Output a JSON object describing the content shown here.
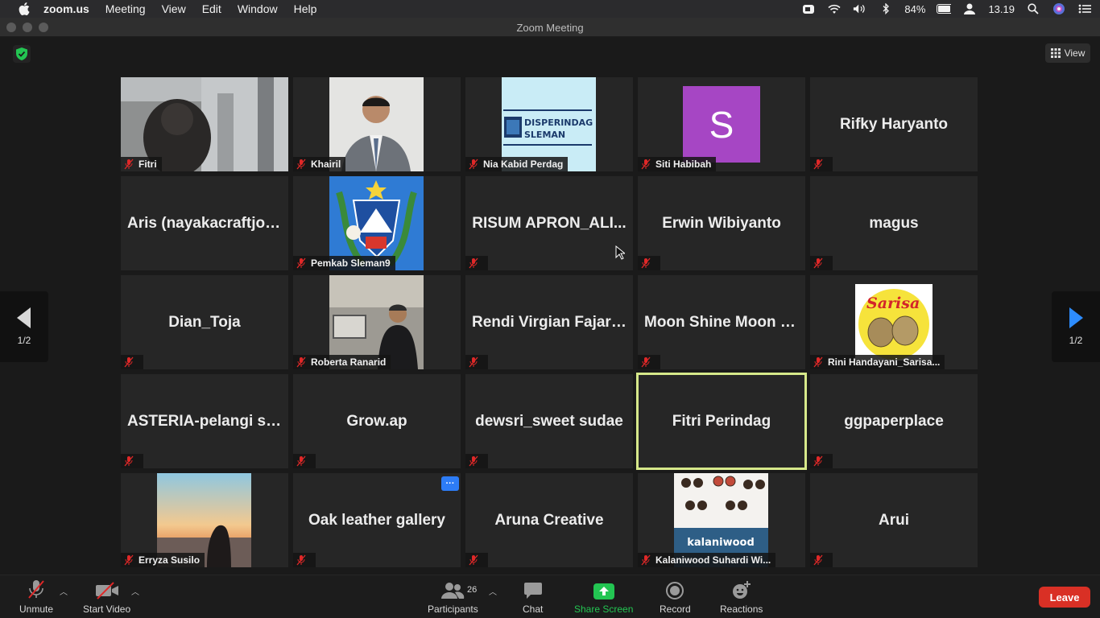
{
  "menubar": {
    "app": "zoom.us",
    "items": [
      "Meeting",
      "View",
      "Edit",
      "Window",
      "Help"
    ],
    "battery": "84%",
    "time": "13.19"
  },
  "window": {
    "title": "Zoom Meeting"
  },
  "view_button": "View",
  "pagination": {
    "left": "1/2",
    "right": "1/2"
  },
  "tiles": [
    {
      "name": "Fitri",
      "big": ""
    },
    {
      "name": "Khairil",
      "big": ""
    },
    {
      "name": "Nia Kabid Perdag",
      "big": ""
    },
    {
      "name": "Siti Habibah",
      "big": ""
    },
    {
      "name": "",
      "big": "Rifky Haryanto"
    },
    {
      "name": "",
      "big": "Aris (nayakacraftjog..."
    },
    {
      "name": "Pemkab Sleman9",
      "big": ""
    },
    {
      "name": "",
      "big": "RISUM APRON_ALI..."
    },
    {
      "name": "",
      "big": "Erwin Wibiyanto"
    },
    {
      "name": "",
      "big": "magus"
    },
    {
      "name": "",
      "big": "Dian_Toja"
    },
    {
      "name": "Roberta Ranarid",
      "big": ""
    },
    {
      "name": "",
      "big": "Rendi Virgian Fajary..."
    },
    {
      "name": "",
      "big": "Moon Shine Moon S..."
    },
    {
      "name": "Rini Handayani_Sarisa...",
      "big": ""
    },
    {
      "name": "",
      "big": "ASTERIA-pelangi se..."
    },
    {
      "name": "",
      "big": "Grow.ap"
    },
    {
      "name": "",
      "big": "dewsri_sweet sudae"
    },
    {
      "name": "",
      "big": "Fitri Perindag"
    },
    {
      "name": "",
      "big": "ggpaperplace"
    },
    {
      "name": "Erryza Susilo",
      "big": ""
    },
    {
      "name": "",
      "big": "Oak leather gallery"
    },
    {
      "name": "",
      "big": "Aruna Creative"
    },
    {
      "name": "Kalaniwood Suhardi Wi...",
      "big": ""
    },
    {
      "name": "",
      "big": "Arui"
    }
  ],
  "avatar_texts": {
    "siti": "S",
    "disperindag_line1": "DISPERINDAG",
    "disperindag_line2": "SLEMAN",
    "sarisa": "Sarisa",
    "kalaniwood": "kalaniwood"
  },
  "toolbar": {
    "unmute": "Unmute",
    "start_video": "Start Video",
    "participants": "Participants",
    "participant_count": "26",
    "chat": "Chat",
    "share_screen": "Share Screen",
    "record": "Record",
    "reactions": "Reactions",
    "leave": "Leave"
  },
  "colors": {
    "active_speaker": "#d6e88a",
    "leave": "#d93025",
    "share": "#23c552",
    "muted_mic": "#e02828"
  }
}
